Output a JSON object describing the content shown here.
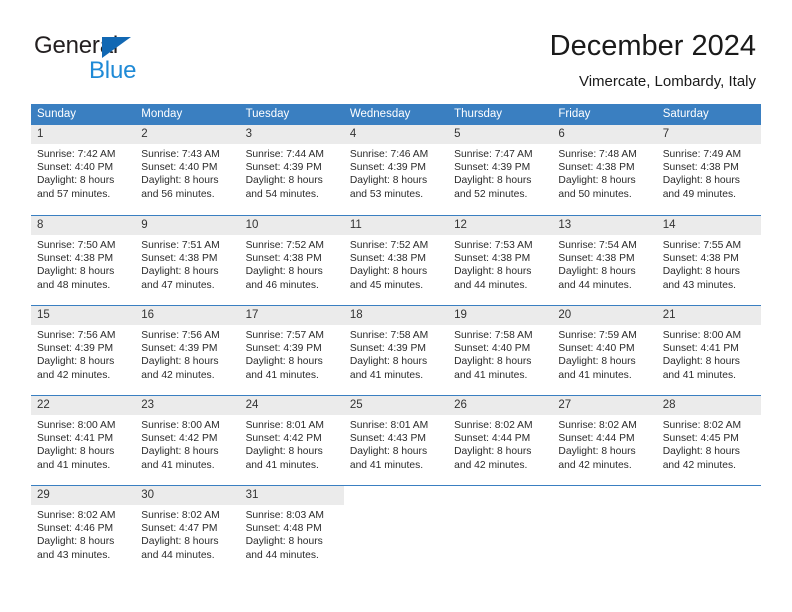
{
  "brand": {
    "name_top": "General",
    "name_bottom": "Blue",
    "triangle_color": "#1268b3",
    "blue_color": "#1f8ad6"
  },
  "header": {
    "title": "December 2024",
    "location": "Vimercate, Lombardy, Italy"
  },
  "theme": {
    "header_bar": "#3a7fc1",
    "daynum_band": "#ebebeb",
    "separator": "#3a7fc1"
  },
  "weekday_headers": [
    "Sunday",
    "Monday",
    "Tuesday",
    "Wednesday",
    "Thursday",
    "Friday",
    "Saturday"
  ],
  "weeks": [
    [
      {
        "day": "1",
        "sunrise": "Sunrise: 7:42 AM",
        "sunset": "Sunset: 4:40 PM",
        "daylight1": "Daylight: 8 hours",
        "daylight2": "and 57 minutes."
      },
      {
        "day": "2",
        "sunrise": "Sunrise: 7:43 AM",
        "sunset": "Sunset: 4:40 PM",
        "daylight1": "Daylight: 8 hours",
        "daylight2": "and 56 minutes."
      },
      {
        "day": "3",
        "sunrise": "Sunrise: 7:44 AM",
        "sunset": "Sunset: 4:39 PM",
        "daylight1": "Daylight: 8 hours",
        "daylight2": "and 54 minutes."
      },
      {
        "day": "4",
        "sunrise": "Sunrise: 7:46 AM",
        "sunset": "Sunset: 4:39 PM",
        "daylight1": "Daylight: 8 hours",
        "daylight2": "and 53 minutes."
      },
      {
        "day": "5",
        "sunrise": "Sunrise: 7:47 AM",
        "sunset": "Sunset: 4:39 PM",
        "daylight1": "Daylight: 8 hours",
        "daylight2": "and 52 minutes."
      },
      {
        "day": "6",
        "sunrise": "Sunrise: 7:48 AM",
        "sunset": "Sunset: 4:38 PM",
        "daylight1": "Daylight: 8 hours",
        "daylight2": "and 50 minutes."
      },
      {
        "day": "7",
        "sunrise": "Sunrise: 7:49 AM",
        "sunset": "Sunset: 4:38 PM",
        "daylight1": "Daylight: 8 hours",
        "daylight2": "and 49 minutes."
      }
    ],
    [
      {
        "day": "8",
        "sunrise": "Sunrise: 7:50 AM",
        "sunset": "Sunset: 4:38 PM",
        "daylight1": "Daylight: 8 hours",
        "daylight2": "and 48 minutes."
      },
      {
        "day": "9",
        "sunrise": "Sunrise: 7:51 AM",
        "sunset": "Sunset: 4:38 PM",
        "daylight1": "Daylight: 8 hours",
        "daylight2": "and 47 minutes."
      },
      {
        "day": "10",
        "sunrise": "Sunrise: 7:52 AM",
        "sunset": "Sunset: 4:38 PM",
        "daylight1": "Daylight: 8 hours",
        "daylight2": "and 46 minutes."
      },
      {
        "day": "11",
        "sunrise": "Sunrise: 7:52 AM",
        "sunset": "Sunset: 4:38 PM",
        "daylight1": "Daylight: 8 hours",
        "daylight2": "and 45 minutes."
      },
      {
        "day": "12",
        "sunrise": "Sunrise: 7:53 AM",
        "sunset": "Sunset: 4:38 PM",
        "daylight1": "Daylight: 8 hours",
        "daylight2": "and 44 minutes."
      },
      {
        "day": "13",
        "sunrise": "Sunrise: 7:54 AM",
        "sunset": "Sunset: 4:38 PM",
        "daylight1": "Daylight: 8 hours",
        "daylight2": "and 44 minutes."
      },
      {
        "day": "14",
        "sunrise": "Sunrise: 7:55 AM",
        "sunset": "Sunset: 4:38 PM",
        "daylight1": "Daylight: 8 hours",
        "daylight2": "and 43 minutes."
      }
    ],
    [
      {
        "day": "15",
        "sunrise": "Sunrise: 7:56 AM",
        "sunset": "Sunset: 4:39 PM",
        "daylight1": "Daylight: 8 hours",
        "daylight2": "and 42 minutes."
      },
      {
        "day": "16",
        "sunrise": "Sunrise: 7:56 AM",
        "sunset": "Sunset: 4:39 PM",
        "daylight1": "Daylight: 8 hours",
        "daylight2": "and 42 minutes."
      },
      {
        "day": "17",
        "sunrise": "Sunrise: 7:57 AM",
        "sunset": "Sunset: 4:39 PM",
        "daylight1": "Daylight: 8 hours",
        "daylight2": "and 41 minutes."
      },
      {
        "day": "18",
        "sunrise": "Sunrise: 7:58 AM",
        "sunset": "Sunset: 4:39 PM",
        "daylight1": "Daylight: 8 hours",
        "daylight2": "and 41 minutes."
      },
      {
        "day": "19",
        "sunrise": "Sunrise: 7:58 AM",
        "sunset": "Sunset: 4:40 PM",
        "daylight1": "Daylight: 8 hours",
        "daylight2": "and 41 minutes."
      },
      {
        "day": "20",
        "sunrise": "Sunrise: 7:59 AM",
        "sunset": "Sunset: 4:40 PM",
        "daylight1": "Daylight: 8 hours",
        "daylight2": "and 41 minutes."
      },
      {
        "day": "21",
        "sunrise": "Sunrise: 8:00 AM",
        "sunset": "Sunset: 4:41 PM",
        "daylight1": "Daylight: 8 hours",
        "daylight2": "and 41 minutes."
      }
    ],
    [
      {
        "day": "22",
        "sunrise": "Sunrise: 8:00 AM",
        "sunset": "Sunset: 4:41 PM",
        "daylight1": "Daylight: 8 hours",
        "daylight2": "and 41 minutes."
      },
      {
        "day": "23",
        "sunrise": "Sunrise: 8:00 AM",
        "sunset": "Sunset: 4:42 PM",
        "daylight1": "Daylight: 8 hours",
        "daylight2": "and 41 minutes."
      },
      {
        "day": "24",
        "sunrise": "Sunrise: 8:01 AM",
        "sunset": "Sunset: 4:42 PM",
        "daylight1": "Daylight: 8 hours",
        "daylight2": "and 41 minutes."
      },
      {
        "day": "25",
        "sunrise": "Sunrise: 8:01 AM",
        "sunset": "Sunset: 4:43 PM",
        "daylight1": "Daylight: 8 hours",
        "daylight2": "and 41 minutes."
      },
      {
        "day": "26",
        "sunrise": "Sunrise: 8:02 AM",
        "sunset": "Sunset: 4:44 PM",
        "daylight1": "Daylight: 8 hours",
        "daylight2": "and 42 minutes."
      },
      {
        "day": "27",
        "sunrise": "Sunrise: 8:02 AM",
        "sunset": "Sunset: 4:44 PM",
        "daylight1": "Daylight: 8 hours",
        "daylight2": "and 42 minutes."
      },
      {
        "day": "28",
        "sunrise": "Sunrise: 8:02 AM",
        "sunset": "Sunset: 4:45 PM",
        "daylight1": "Daylight: 8 hours",
        "daylight2": "and 42 minutes."
      }
    ],
    [
      {
        "day": "29",
        "sunrise": "Sunrise: 8:02 AM",
        "sunset": "Sunset: 4:46 PM",
        "daylight1": "Daylight: 8 hours",
        "daylight2": "and 43 minutes."
      },
      {
        "day": "30",
        "sunrise": "Sunrise: 8:02 AM",
        "sunset": "Sunset: 4:47 PM",
        "daylight1": "Daylight: 8 hours",
        "daylight2": "and 44 minutes."
      },
      {
        "day": "31",
        "sunrise": "Sunrise: 8:03 AM",
        "sunset": "Sunset: 4:48 PM",
        "daylight1": "Daylight: 8 hours",
        "daylight2": "and 44 minutes."
      },
      {
        "day": "",
        "sunrise": "",
        "sunset": "",
        "daylight1": "",
        "daylight2": ""
      },
      {
        "day": "",
        "sunrise": "",
        "sunset": "",
        "daylight1": "",
        "daylight2": ""
      },
      {
        "day": "",
        "sunrise": "",
        "sunset": "",
        "daylight1": "",
        "daylight2": ""
      },
      {
        "day": "",
        "sunrise": "",
        "sunset": "",
        "daylight1": "",
        "daylight2": ""
      }
    ]
  ]
}
